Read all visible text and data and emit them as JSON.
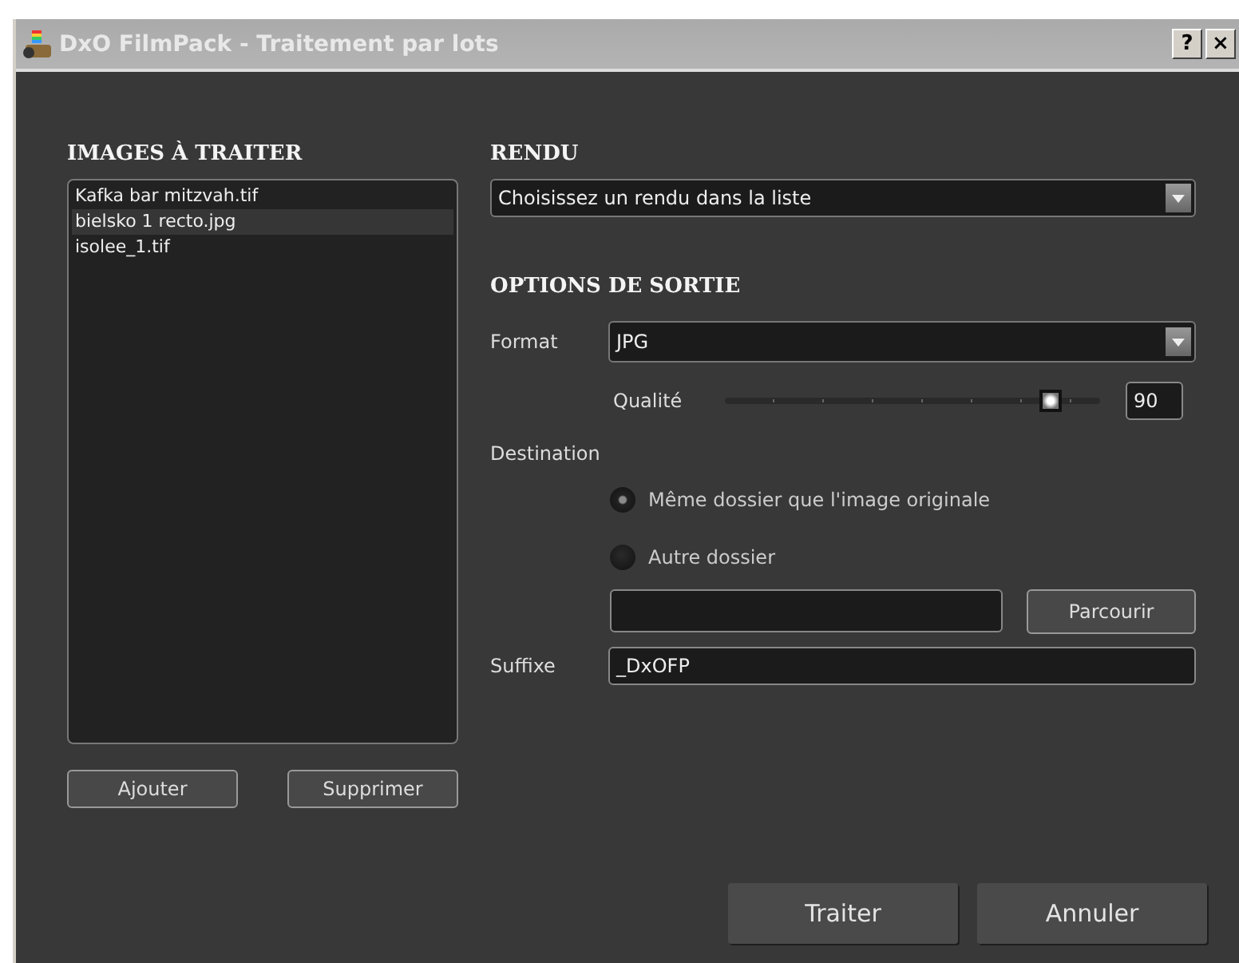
{
  "window": {
    "title": "DxO FilmPack - Traitement par lots",
    "help_button": "?",
    "close_button": "×"
  },
  "images": {
    "heading": "IMAGES À TRAITER",
    "files": [
      {
        "name": "Kafka bar mitzvah.tif",
        "selected": false
      },
      {
        "name": "bielsko 1 recto.jpg",
        "selected": true
      },
      {
        "name": "isolee_1.tif",
        "selected": false
      }
    ],
    "buttons": [
      "Ajouter",
      "Supprimer"
    ]
  },
  "rendu": {
    "heading": "RENDU",
    "dropdown": "Choisissez un rendu dans la liste"
  },
  "output": {
    "heading": "OPTIONS DE SORTIE",
    "format_label": "Format",
    "format": "JPG",
    "quality_label": "Qualité",
    "quality": {
      "level": 0.87
    },
    "quality_value": "90",
    "destination_label": "Destination",
    "destinations": [
      {
        "label": "Même dossier que l'image originale",
        "selected": true
      },
      {
        "label": "Autre dossier",
        "selected": false
      }
    ],
    "browse_button": "Parcourir",
    "suffix_label": "Suffixe",
    "suffix": "_DxOFP"
  },
  "footer_buttons": [
    "Traiter",
    "Annuler"
  ]
}
